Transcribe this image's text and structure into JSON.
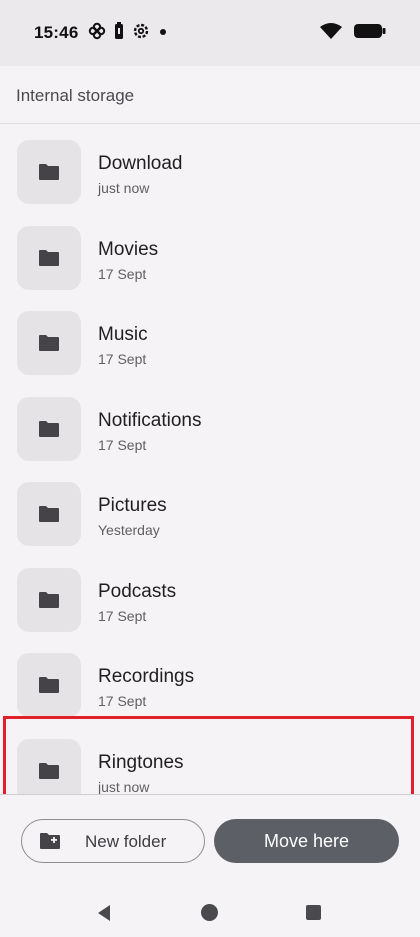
{
  "status_bar": {
    "time": "15:46",
    "icons": [
      "fan-icon",
      "battery-saver-icon",
      "settings-icon",
      "notification-dot-icon"
    ],
    "right_icons": [
      "wifi-icon",
      "battery-icon"
    ]
  },
  "header": {
    "title": "Internal storage"
  },
  "folders": [
    {
      "name": "Download",
      "date": "just now"
    },
    {
      "name": "Movies",
      "date": "17 Sept"
    },
    {
      "name": "Music",
      "date": "17 Sept"
    },
    {
      "name": "Notifications",
      "date": "17 Sept"
    },
    {
      "name": "Pictures",
      "date": "Yesterday"
    },
    {
      "name": "Podcasts",
      "date": "17 Sept"
    },
    {
      "name": "Recordings",
      "date": "17 Sept"
    },
    {
      "name": "Ringtones",
      "date": "just now"
    }
  ],
  "actions": {
    "new_folder_label": "New folder",
    "move_here_label": "Move here"
  },
  "colors": {
    "highlight": "#e2202c",
    "primary_button": "#5d5f67",
    "folder_tile": "#e6e3e7"
  }
}
